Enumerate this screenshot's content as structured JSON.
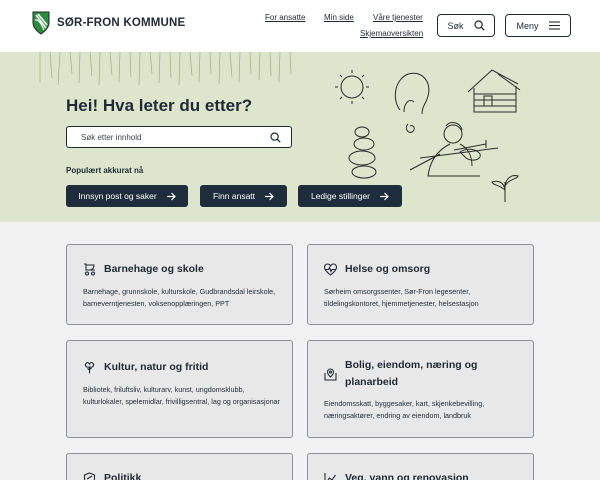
{
  "header": {
    "logo_text": "SØR-FRON KOMMUNE",
    "links": {
      "for_ansatte": "For ansatte",
      "min_side": "Min side",
      "vare_tjenester": "Våre tjenester",
      "skjemaoversikten": "Skjemaoversikten"
    },
    "search_button": "Søk",
    "menu_button": "Meny"
  },
  "hero": {
    "title": "Hei! Hva leter du etter?",
    "search_placeholder": "Søk etter innhold",
    "popular_label": "Populært akkurat nå",
    "quick_links": [
      "Innsyn post og saker",
      "Finn ansatt",
      "Ledige stillinger"
    ]
  },
  "cards": [
    {
      "icon": "stroller-icon",
      "title": "Barnehage og skole",
      "description": "Barnehage, grunnskole, kulturskole, Gudbrandsdal leirskole, barneverntjenesten, voksenopplæringen, PPT"
    },
    {
      "icon": "heart-pulse-icon",
      "title": "Helse og omsorg",
      "description": "Sørheim omsorgssenter, Sør-Fron legesenter, tildelingskontoret, hjemmetjenester, helsestasjon"
    },
    {
      "icon": "tree-icon",
      "title": "Kultur, natur og fritid",
      "description": "Bibliotek, friluftsliv, kulturarv, kunst, ungdomsklubb, kulturlokaler, spelemidlar, frivilligsentral, lag og organisasjonar"
    },
    {
      "icon": "map-pin-icon",
      "title": "Bolig, eiendom, næring og planarbeid",
      "description": "Eiendomsskatt, byggesaker, kart, skjenkebevilling, næringsaktører, endring av eiendom, landbruk"
    },
    {
      "icon": "shield-icon",
      "title": "Politikk",
      "description": ""
    },
    {
      "icon": "chart-line-icon",
      "title": "Veg, vann og renovasjon",
      "description": ""
    }
  ],
  "colors": {
    "brand_navy": "#1e2d3b",
    "hero_bg": "#dee5cd",
    "logo_green": "#2e8b3a",
    "card_bg": "#e8e8e8"
  }
}
